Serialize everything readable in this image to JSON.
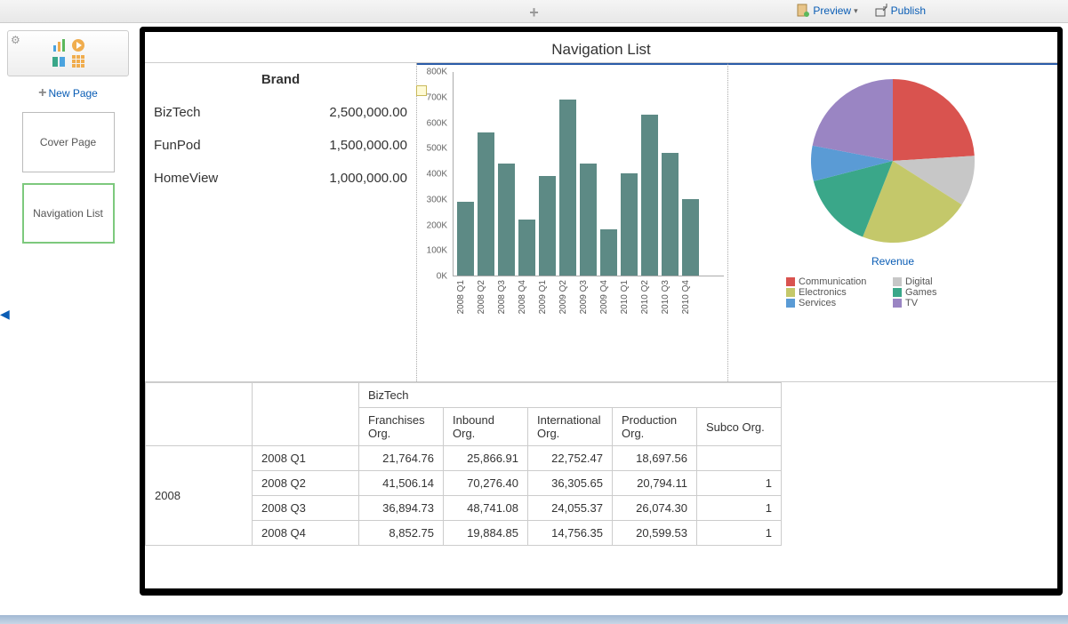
{
  "topbar": {
    "preview": "Preview",
    "publish": "Publish"
  },
  "sidebar": {
    "new_page": "New Page",
    "thumbs": [
      {
        "label": "Cover Page"
      },
      {
        "label": "Navigation List"
      }
    ]
  },
  "page": {
    "title": "Navigation List"
  },
  "brand_table": {
    "header": "Brand",
    "rows": [
      {
        "name": "BizTech",
        "value": "2,500,000.00"
      },
      {
        "name": "FunPod",
        "value": "1,500,000.00"
      },
      {
        "name": "HomeView",
        "value": "1,000,000.00"
      }
    ]
  },
  "chart_data": [
    {
      "type": "bar",
      "categories": [
        "2008 Q1",
        "2008 Q2",
        "2008 Q3",
        "2008 Q4",
        "2009 Q1",
        "2009 Q2",
        "2009 Q3",
        "2009 Q4",
        "2010 Q1",
        "2010 Q2",
        "2010 Q3",
        "2010 Q4"
      ],
      "values": [
        290000,
        560000,
        440000,
        220000,
        390000,
        690000,
        440000,
        180000,
        400000,
        630000,
        480000,
        300000
      ],
      "ylim": [
        0,
        800000
      ],
      "yticks": [
        "0K",
        "100K",
        "200K",
        "300K",
        "400K",
        "500K",
        "600K",
        "700K",
        "800K"
      ]
    },
    {
      "type": "pie",
      "title": "Revenue",
      "series": [
        {
          "name": "Communication",
          "value": 24,
          "color": "#d9534f"
        },
        {
          "name": "Digital",
          "value": 10,
          "color": "#c7c7c7"
        },
        {
          "name": "Electronics",
          "value": 22,
          "color": "#c4c86a"
        },
        {
          "name": "Games",
          "value": 15,
          "color": "#3aa789"
        },
        {
          "name": "Services",
          "value": 7,
          "color": "#5a9bd5"
        },
        {
          "name": "TV",
          "value": 22,
          "color": "#9a85c3"
        }
      ]
    }
  ],
  "pivot": {
    "top_header": "BizTech",
    "columns": [
      "Franchises Org.",
      "Inbound Org.",
      "International Org.",
      "Production Org.",
      "Subco Org."
    ],
    "year": "2008",
    "rows": [
      {
        "q": "2008 Q1",
        "vals": [
          "21,764.76",
          "25,866.91",
          "22,752.47",
          "18,697.56",
          ""
        ]
      },
      {
        "q": "2008 Q2",
        "vals": [
          "41,506.14",
          "70,276.40",
          "36,305.65",
          "20,794.11",
          "1"
        ]
      },
      {
        "q": "2008 Q3",
        "vals": [
          "36,894.73",
          "48,741.08",
          "24,055.37",
          "26,074.30",
          "1"
        ]
      },
      {
        "q": "2008 Q4",
        "vals": [
          "8,852.75",
          "19,884.85",
          "14,756.35",
          "20,599.53",
          "1"
        ]
      }
    ]
  }
}
